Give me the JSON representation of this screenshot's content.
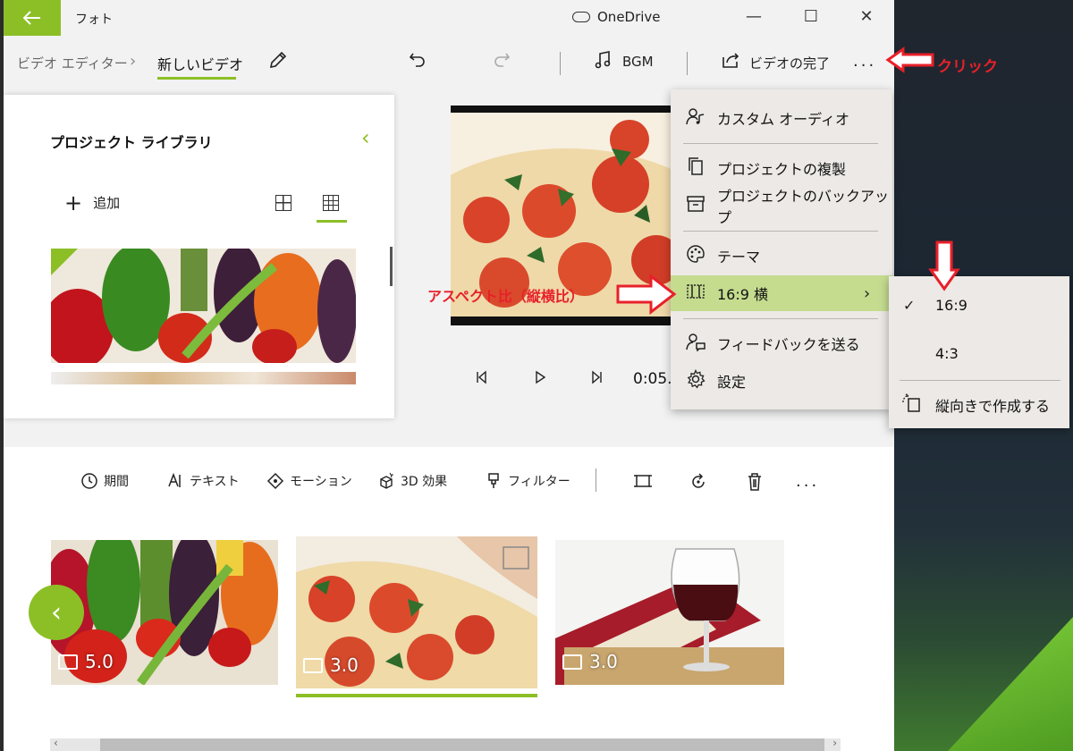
{
  "window": {
    "app_title": "フォト",
    "account": "OneDrive",
    "back_icon": "arrow-left-icon",
    "minimize": "—",
    "maximize": "☐",
    "close": "✕"
  },
  "toolbar": {
    "breadcrumb_parent": "ビデオ エディター",
    "breadcrumb_sep": "›",
    "breadcrumb_current": "新しいビデオ",
    "bgm_label": "BGM",
    "finish_label": "ビデオの完了",
    "more": "..."
  },
  "library": {
    "title": "プロジェクト ライブラリ",
    "add_label": "追加",
    "collapse": "‹"
  },
  "playback": {
    "time": "0:05."
  },
  "menu": {
    "items": [
      {
        "icon": "custom-audio-icon",
        "label": "カスタム オーディオ"
      },
      {
        "icon": "duplicate-icon",
        "label": "プロジェクトの複製"
      },
      {
        "icon": "backup-icon",
        "label": "プロジェクトのバックアップ"
      },
      {
        "icon": "palette-icon",
        "label": "テーマ"
      },
      {
        "icon": "aspect-ratio-icon",
        "label": "16:9 横"
      },
      {
        "icon": "feedback-icon",
        "label": "フィードバックを送る"
      },
      {
        "icon": "gear-icon",
        "label": "設定"
      }
    ],
    "chevron": "›"
  },
  "submenu": {
    "items": [
      {
        "label": "16:9",
        "checked": true
      },
      {
        "label": "4:3",
        "checked": false
      },
      {
        "label": "縦向きで作成する",
        "icon": "rotate-portrait-icon"
      }
    ],
    "check": "✓"
  },
  "clip_tools": {
    "duration": "期間",
    "text": "テキスト",
    "motion": "モーション",
    "effects_3d": "3D 効果",
    "filter": "フィルター",
    "more": "..."
  },
  "storyboard": {
    "clips": [
      {
        "duration": "5.0",
        "subject": "vegetables"
      },
      {
        "duration": "3.0",
        "subject": "pizza",
        "selected": true
      },
      {
        "duration": "3.0",
        "subject": "wine"
      }
    ],
    "nav_prev": "‹"
  },
  "annotations": {
    "click_label": "クリック",
    "aspect_label": "アスペクト比（縦横比）",
    "color": "#e8202a"
  },
  "colors": {
    "accent": "#8cbf26",
    "menu_bg": "#ece9e6",
    "menu_highlight": "#c5dc8f"
  }
}
